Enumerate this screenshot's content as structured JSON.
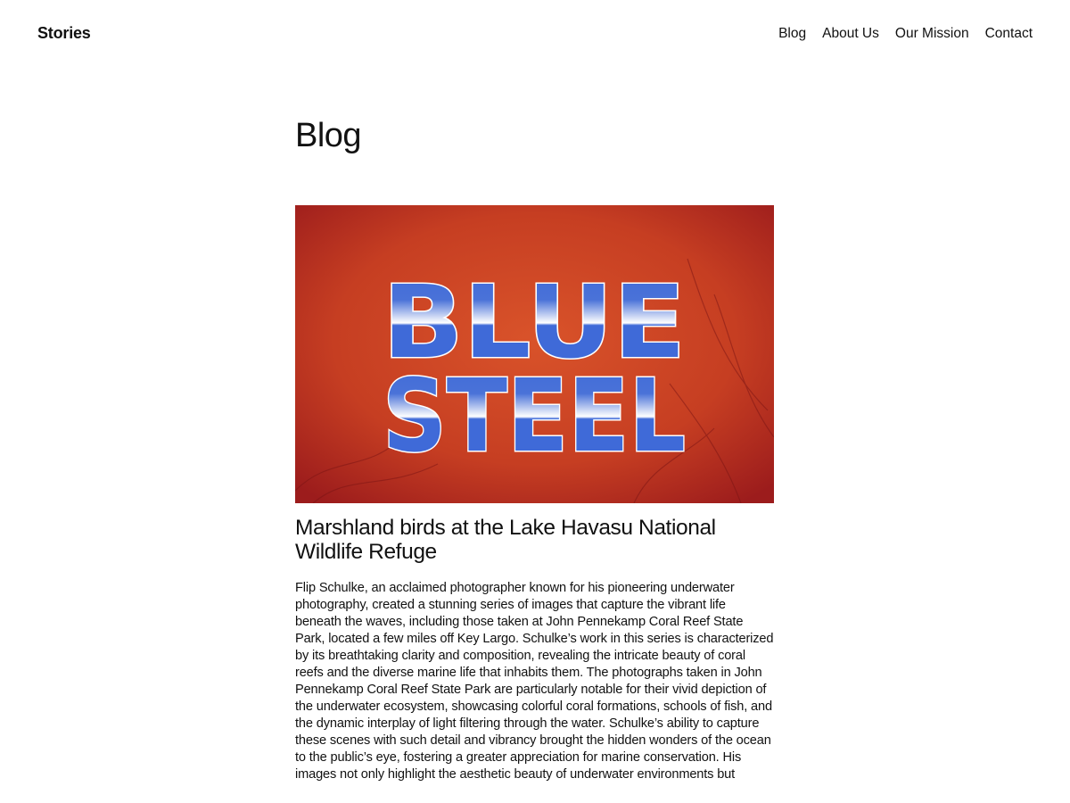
{
  "header": {
    "site_title": "Stories",
    "nav": [
      "Blog",
      "About Us",
      "Our Mission",
      "Contact"
    ]
  },
  "main": {
    "page_title": "Blog",
    "post": {
      "image_logo_text": [
        "BLUE",
        "STEEL"
      ],
      "title": "Marshland birds at the Lake Havasu National Wildlife Refuge",
      "excerpt": "Flip Schulke, an acclaimed photographer known for his pioneering underwater photography, created a stunning series of images that capture the vibrant life beneath the waves, including those taken at John Pennekamp Coral Reef State Park, located a few miles off Key Largo. Schulke’s work in this series is characterized by its breathtaking clarity and composition, revealing the intricate beauty of coral reefs and the diverse marine life that inhabits them. The photographs taken in John Pennekamp Coral Reef State Park are particularly notable for their vivid depiction of the underwater ecosystem, showcasing colorful coral formations, schools of fish, and the dynamic interplay of light filtering through the water. Schulke’s ability to capture these scenes with such detail and vibrancy brought the hidden wonders of the ocean to the public’s eye, fostering a greater appreciation for marine conservation. His images not only highlight the aesthetic beauty of underwater environments but"
    }
  },
  "colors": {
    "logo_blue": "#3f6ad8",
    "background_red": "#c8401f"
  }
}
